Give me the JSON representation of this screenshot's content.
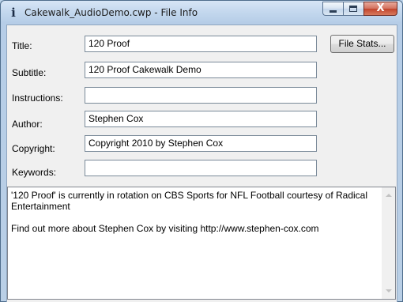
{
  "window": {
    "title": "Cakewalk_AudioDemo.cwp - File Info",
    "close_glyph": "X"
  },
  "form": {
    "title_label": "Title:",
    "title_value": "120 Proof",
    "subtitle_label": "Subtitle:",
    "subtitle_value": "120 Proof Cakewalk Demo",
    "instructions_label": "Instructions:",
    "instructions_value": "",
    "author_label": "Author:",
    "author_value": "Stephen Cox",
    "copyright_label": "Copyright:",
    "copyright_value": "Copyright  2010 by Stephen Cox",
    "keywords_label": "Keywords:",
    "keywords_value": ""
  },
  "buttons": {
    "file_stats": "File Stats..."
  },
  "notes": {
    "line1": "'120 Proof' is currently in rotation on CBS Sports for NFL Football courtesy of Radical Entertainment",
    "line2": "Find out more about Stephen Cox by visiting http://www.stephen-cox.com"
  }
}
